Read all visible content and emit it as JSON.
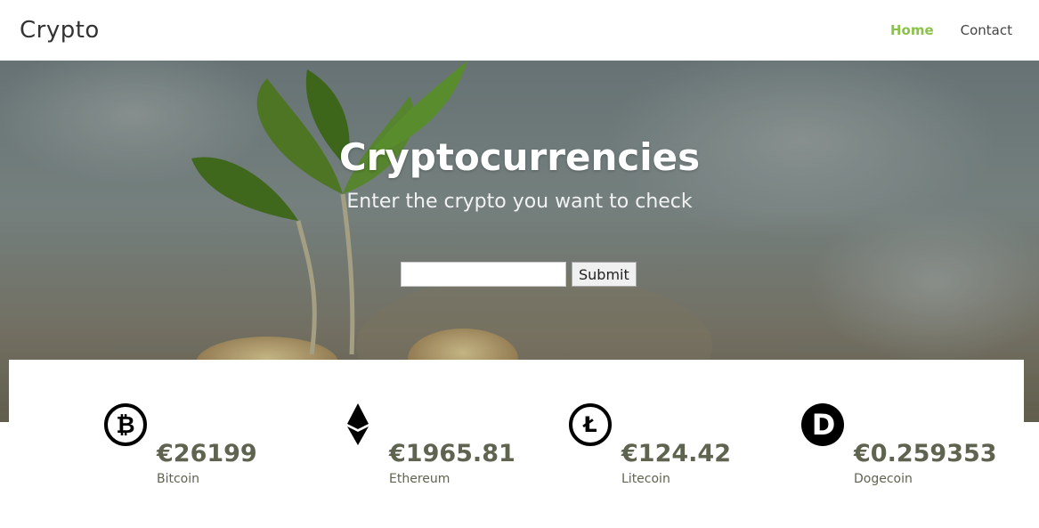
{
  "navbar": {
    "brand": "Crypto",
    "links": [
      {
        "label": "Home",
        "active": true
      },
      {
        "label": "Contact",
        "active": false
      }
    ],
    "accent_color": "#8bc34a"
  },
  "hero": {
    "title": "Cryptocurrencies",
    "subtitle": "Enter the crypto you want to check",
    "search": {
      "value": "",
      "placeholder": ""
    },
    "submit_label": "Submit"
  },
  "coins": [
    {
      "name": "Bitcoin",
      "price": "€26199",
      "icon": "bitcoin-icon"
    },
    {
      "name": "Ethereum",
      "price": "€1965.81",
      "icon": "ethereum-icon"
    },
    {
      "name": "Litecoin",
      "price": "€124.42",
      "icon": "litecoin-icon"
    },
    {
      "name": "Dogecoin",
      "price": "€0.259353",
      "icon": "dogecoin-icon"
    }
  ]
}
